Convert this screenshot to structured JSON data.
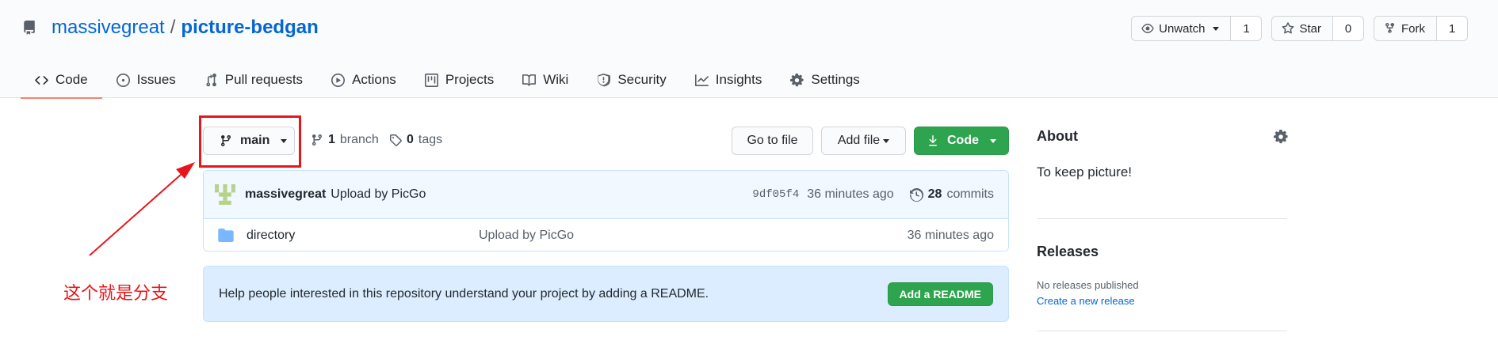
{
  "repo": {
    "owner": "massivegreat",
    "separator": "/",
    "name": "picture-bedgan"
  },
  "actions": {
    "watch_label": "Unwatch",
    "watch_count": "1",
    "star_label": "Star",
    "star_count": "0",
    "fork_label": "Fork",
    "fork_count": "1"
  },
  "tabs": [
    {
      "label": "Code",
      "icon": "code-icon"
    },
    {
      "label": "Issues",
      "icon": "issue-icon"
    },
    {
      "label": "Pull requests",
      "icon": "pull-request-icon"
    },
    {
      "label": "Actions",
      "icon": "play-icon"
    },
    {
      "label": "Projects",
      "icon": "project-icon"
    },
    {
      "label": "Wiki",
      "icon": "book-icon"
    },
    {
      "label": "Security",
      "icon": "shield-icon"
    },
    {
      "label": "Insights",
      "icon": "graph-icon"
    },
    {
      "label": "Settings",
      "icon": "gear-icon"
    }
  ],
  "file_nav": {
    "branch": "main",
    "branch_count": "1",
    "branch_label": "branch",
    "tag_count": "0",
    "tag_label": "tags",
    "go_to_file": "Go to file",
    "add_file": "Add file",
    "code": "Code"
  },
  "commit": {
    "author": "massivegreat",
    "message": "Upload by PicGo",
    "sha": "9df05f4",
    "age": "36 minutes ago",
    "commit_count": "28",
    "commits_label": "commits"
  },
  "files": [
    {
      "name": "directory",
      "message": "Upload by PicGo",
      "age": "36 minutes ago",
      "icon": "folder-icon"
    }
  ],
  "readme": {
    "text": "Help people interested in this repository understand your project by adding a README.",
    "button": "Add a README"
  },
  "about": {
    "title": "About",
    "description": "To keep picture!"
  },
  "releases": {
    "title": "Releases",
    "none": "No releases published",
    "create": "Create a new release"
  },
  "annotation": {
    "text": "这个就是分支",
    "color": "#e6161b"
  },
  "colors": {
    "link": "#0366d6",
    "green": "#2ea44f",
    "tab_underline": "#f9826c"
  }
}
